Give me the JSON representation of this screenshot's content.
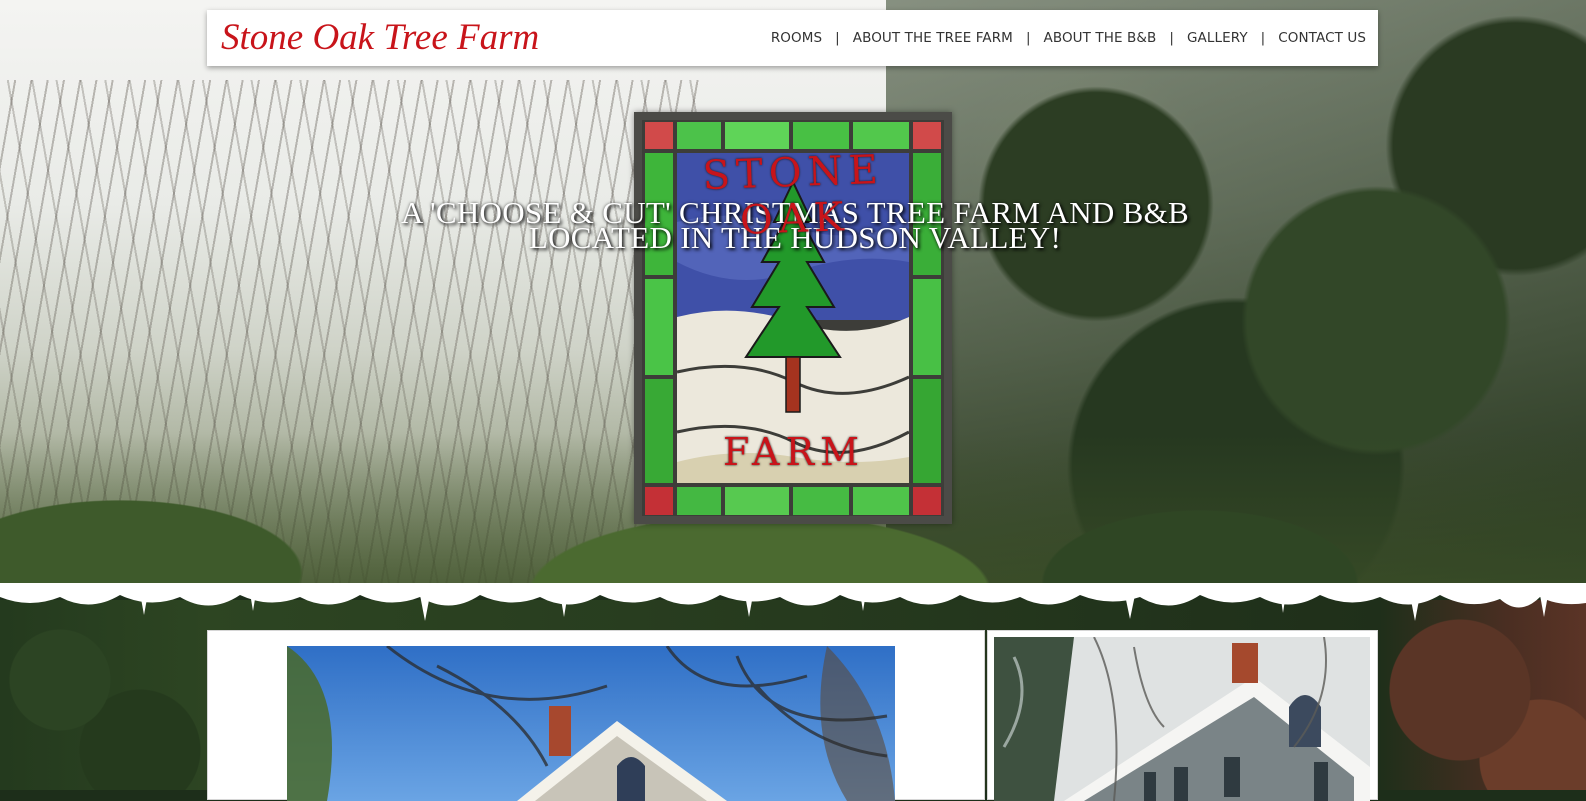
{
  "header": {
    "site_title": "Stone Oak Tree Farm",
    "nav": [
      {
        "label": "ROOMS"
      },
      {
        "label": "ABOUT THE TREE FARM"
      },
      {
        "label": "ABOUT THE B&B"
      },
      {
        "label": "GALLERY"
      },
      {
        "label": "CONTACT US"
      }
    ],
    "separator": "|"
  },
  "hero": {
    "tagline_line1": "A 'CHOOSE & CUT' CHRISTMAS TREE FARM AND B&B",
    "tagline_line2": "LOCATED IN THE HUDSON VALLEY!",
    "sign_top_text": "STONE OAK",
    "sign_bottom_text": "FARM"
  },
  "colors": {
    "title_red": "#c8141a",
    "nav_text": "#333333",
    "glass_green": "#3fb23a",
    "glass_blue": "#3d4fa6",
    "glass_red": "#c21b22"
  }
}
